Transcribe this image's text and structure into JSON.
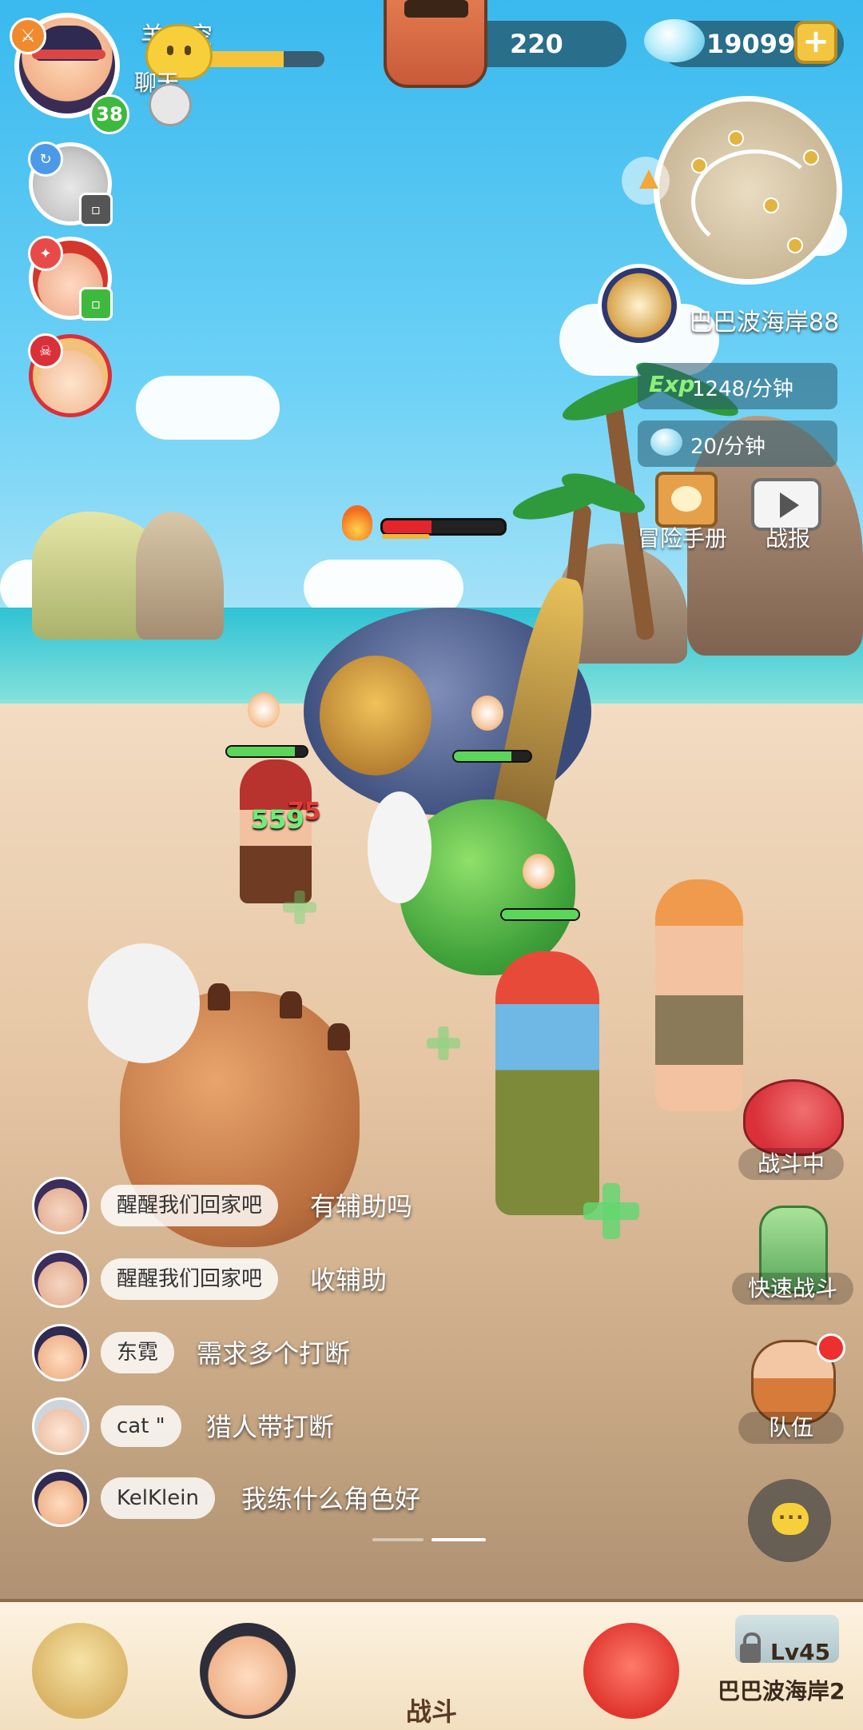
{
  "player": {
    "name": "羊一空",
    "level": "38",
    "chat_label": "聊天"
  },
  "currency": {
    "pearls": "220",
    "gems": "190992",
    "add_symbol": "+"
  },
  "zone": {
    "name": "巴巴波海岸88"
  },
  "rates": {
    "exp_tag": "Exp",
    "exp_rate": "1248/分钟",
    "gem_rate": "20/分钟"
  },
  "side_buttons": {
    "handbook": "冒险手册",
    "battle_report": "战报"
  },
  "battle": {
    "damage_numbers": [
      "559",
      "75"
    ]
  },
  "actions": {
    "in_battle": "战斗中",
    "quick_battle": "快速战斗",
    "team": "队伍"
  },
  "chat": {
    "messages": [
      {
        "nick": "醒醒我们回家吧",
        "text": "有辅助吗"
      },
      {
        "nick": "醒醒我们回家吧",
        "text": "收辅助"
      },
      {
        "nick": "东霓",
        "text": "需求多个打断"
      },
      {
        "nick": "cat \"",
        "text": "猎人带打断"
      },
      {
        "nick": "KelKlein",
        "text": "我练什么角色好"
      }
    ]
  },
  "bottom_nav": {
    "center_label": "战斗",
    "locked_level": "Lv45",
    "locked_zone": "巴巴波海岸2"
  },
  "colors": {
    "hp_green": "#5bd65b",
    "boss_red": "#e2262c",
    "exp_green": "#8ef07a",
    "gold": "#f3c642"
  }
}
